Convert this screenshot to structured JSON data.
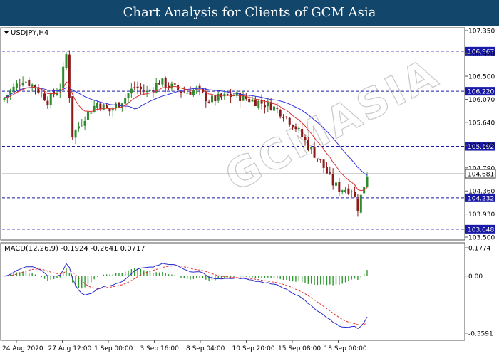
{
  "header": {
    "title": "Chart Analysis for Clients of GCM Asia"
  },
  "price_panel": {
    "symbol_label": "USDJPY,H4",
    "last_price_label": "104.681",
    "y_ticks": [
      "107.350",
      "106.920",
      "106.500",
      "106.070",
      "105.640",
      "105.210",
      "104.790",
      "104.360",
      "103.930",
      "103.500"
    ]
  },
  "macd_panel": {
    "label": "MACD(12,26,9) -0.1924 -0.2641 0.0717",
    "y_ticks": [
      "0.1774",
      "0.00",
      "-0.3591"
    ]
  },
  "x_axis": {
    "labels": [
      "24 Aug 2020",
      "27 Aug 12:00",
      "1 Sep 00:00",
      "3 Sep 16:00",
      "8 Sep 04:00",
      "10 Sep 20:00",
      "15 Sep 08:00",
      "18 Sep 00:00"
    ]
  },
  "watermark": {
    "text": "GCMASIA"
  },
  "colors": {
    "banner": "#13466b",
    "bull": "#2e8b2e",
    "bear": "#8b1a1a",
    "ma_red": "#e03030",
    "ma_blue": "#3333dd",
    "level_line": "#1a1aa8",
    "macd_line": "#2a2ad0",
    "signal": "#e03030",
    "histogram": "#2e9a2e"
  },
  "chart_data": [
    {
      "type": "candlestick",
      "symbol": "USDJPY",
      "timeframe": "H4",
      "ylim": [
        103.5,
        107.35
      ],
      "horizontal_levels": [
        106.967,
        106.22,
        105.192,
        104.232,
        103.648
      ],
      "last_price": 104.681,
      "close_path": [
        [
          0,
          106.1
        ],
        [
          6,
          106.45
        ],
        [
          10,
          106.3
        ],
        [
          14,
          106.05
        ],
        [
          18,
          106.3
        ],
        [
          20,
          106.9
        ],
        [
          22,
          105.4
        ],
        [
          26,
          105.75
        ],
        [
          30,
          106.0
        ],
        [
          34,
          105.85
        ],
        [
          38,
          106.05
        ],
        [
          42,
          106.3
        ],
        [
          46,
          106.2
        ],
        [
          50,
          106.4
        ],
        [
          54,
          106.3
        ],
        [
          58,
          106.2
        ],
        [
          62,
          106.25
        ],
        [
          66,
          106.05
        ],
        [
          70,
          106.1
        ],
        [
          74,
          106.15
        ],
        [
          80,
          106.05
        ],
        [
          86,
          105.95
        ],
        [
          90,
          105.8
        ],
        [
          94,
          105.55
        ],
        [
          98,
          105.2
        ],
        [
          102,
          104.9
        ],
        [
          106,
          104.5
        ],
        [
          108,
          104.4
        ],
        [
          112,
          104.4
        ],
        [
          114,
          104.05
        ],
        [
          117,
          104.68
        ]
      ]
    },
    {
      "type": "line",
      "indicator": "MACD(12,26,9)",
      "macd": -0.1924,
      "signal": -0.2641,
      "histogram": 0.0717,
      "ylim": [
        -0.4,
        0.2
      ]
    }
  ]
}
